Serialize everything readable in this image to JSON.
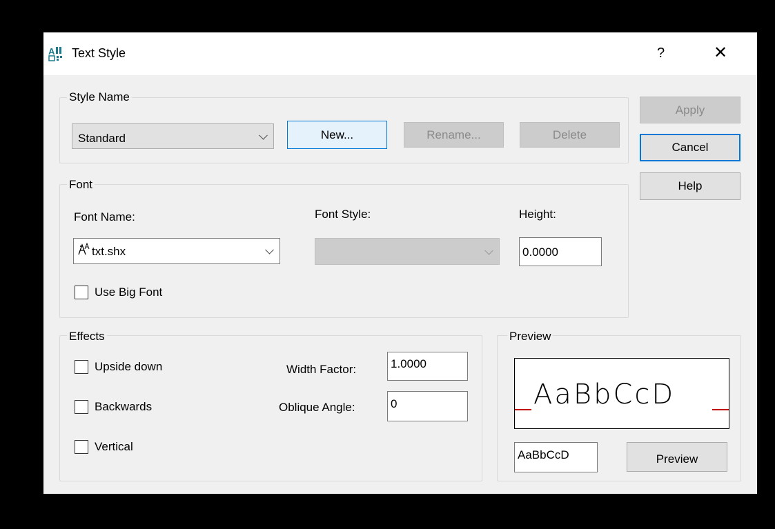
{
  "window": {
    "title": "Text Style",
    "help_glyph": "?",
    "close_glyph": "✕",
    "app_icon": "text-style-icon"
  },
  "style_name": {
    "group_label": "Style Name",
    "selected": "Standard",
    "new_label": "New...",
    "rename_label": "Rename...",
    "delete_label": "Delete"
  },
  "side_buttons": {
    "apply_label": "Apply",
    "cancel_label": "Cancel",
    "help_label": "Help"
  },
  "font": {
    "group_label": "Font",
    "font_name_label": "Font Name:",
    "font_name_value": "txt.shx",
    "font_icon": "shx-font-icon",
    "font_style_label": "Font Style:",
    "font_style_value": "",
    "height_label": "Height:",
    "height_value": "0.0000",
    "use_big_font_label": "Use Big Font",
    "use_big_font_checked": false
  },
  "effects": {
    "group_label": "Effects",
    "upside_down_label": "Upside down",
    "upside_down_checked": false,
    "backwards_label": "Backwards",
    "backwards_checked": false,
    "vertical_label": "Vertical",
    "vertical_checked": false,
    "width_factor_label": "Width Factor:",
    "width_factor_value": "1.0000",
    "oblique_angle_label": "Oblique Angle:",
    "oblique_angle_value": "0"
  },
  "preview": {
    "group_label": "Preview",
    "sample_text": "AaBbCcD",
    "preview_input_value": "AaBbCcD",
    "preview_button_label": "Preview",
    "baseline_color": "#c00000"
  },
  "colors": {
    "accent": "#0078d7",
    "dialog_bg": "#f0f0f0",
    "disabled_bg": "#cccccc"
  }
}
